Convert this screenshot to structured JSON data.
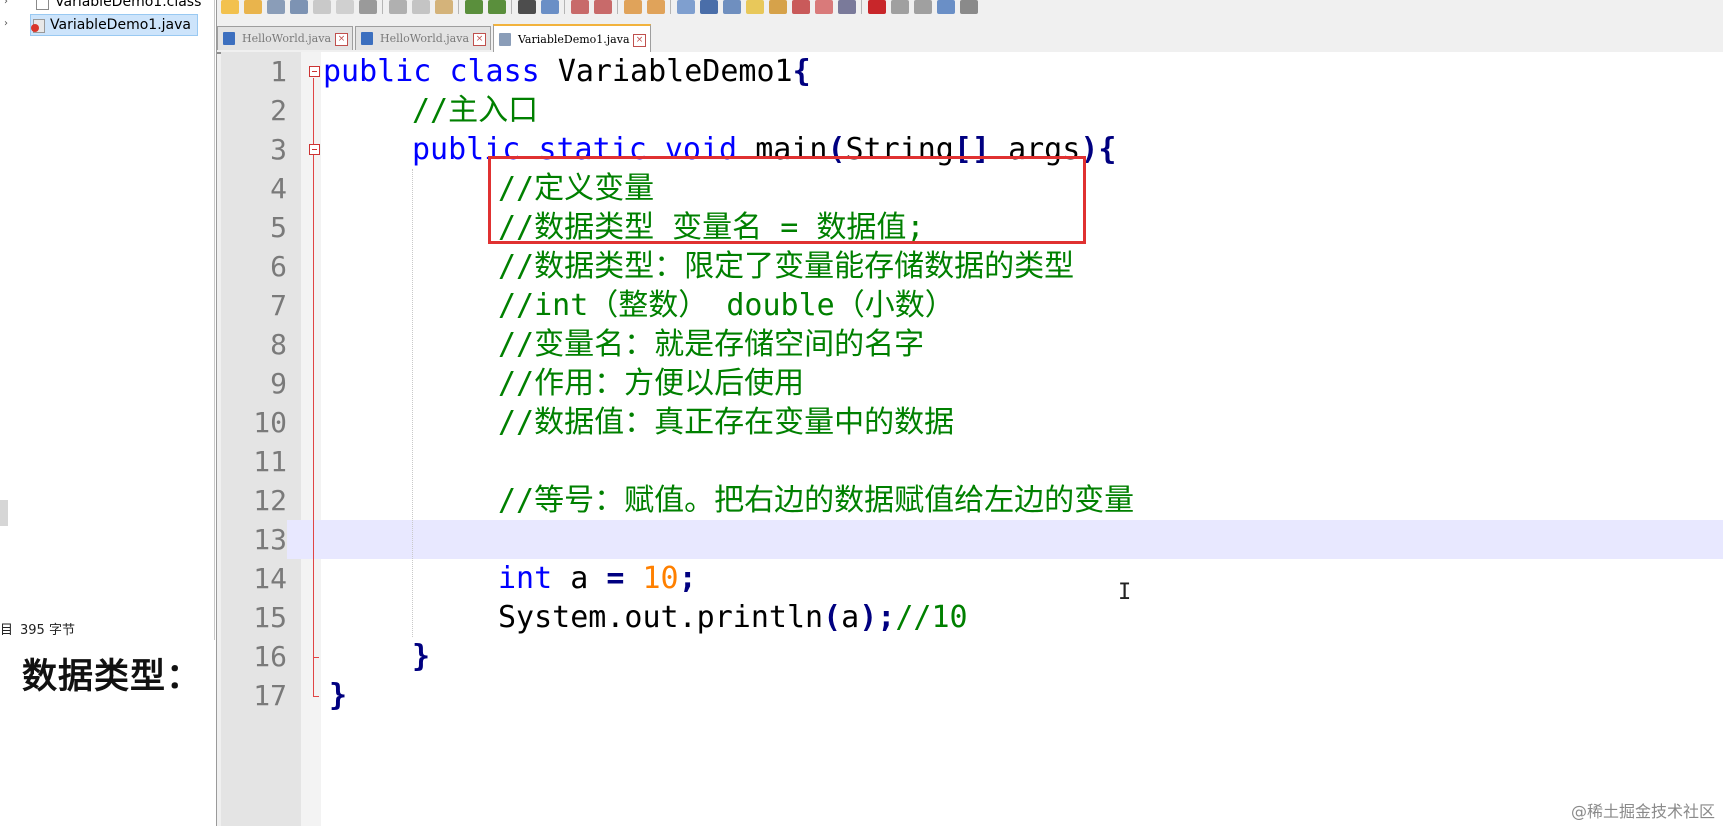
{
  "project_tree": {
    "items": [
      {
        "label": "VariableDemo1.class",
        "icon": "class-file-icon"
      },
      {
        "label": "VariableDemo1.java",
        "icon": "java-file-icon",
        "selected": true
      }
    ]
  },
  "left_status": {
    "prefix": "目",
    "text": "395 字节"
  },
  "overlay_heading": "数据类型：",
  "tabs": [
    {
      "label": "HelloWorld.java",
      "active": false
    },
    {
      "label": "HelloWorld.java",
      "active": false
    },
    {
      "label": "VariableDemo1.java",
      "active": true
    }
  ],
  "code": {
    "current_line": 13,
    "lines": [
      {
        "n": "1",
        "text": "public class VariableDemo1{"
      },
      {
        "n": "2",
        "text": "//主入口"
      },
      {
        "n": "3",
        "text": "public static void main(String[] args){"
      },
      {
        "n": "4",
        "text": "//定义变量"
      },
      {
        "n": "5",
        "text": "//数据类型 变量名 = 数据值;"
      },
      {
        "n": "6",
        "text": "//数据类型：限定了变量能存储数据的类型"
      },
      {
        "n": "7",
        "text": "//int（整数） double（小数）"
      },
      {
        "n": "8",
        "text": "//变量名：就是存储空间的名字"
      },
      {
        "n": "9",
        "text": "//作用：方便以后使用"
      },
      {
        "n": "10",
        "text": "//数据值：真正存在变量中的数据"
      },
      {
        "n": "11",
        "text": ""
      },
      {
        "n": "12",
        "text": "//等号：赋值。把右边的数据赋值给左边的变量"
      },
      {
        "n": "13",
        "text": ""
      },
      {
        "n": "14",
        "text": "int a = 10;"
      },
      {
        "n": "15",
        "text": "System.out.println(a);//10"
      },
      {
        "n": "16",
        "text": "}"
      },
      {
        "n": "17",
        "text": "}"
      }
    ]
  },
  "watermark": "@稀土掘金技术社区",
  "colors": {
    "keyword": "#0000ff",
    "comment": "#008000",
    "number": "#ff8000",
    "highlight_box": "#e03131",
    "current_line": "#e8e8ff"
  }
}
